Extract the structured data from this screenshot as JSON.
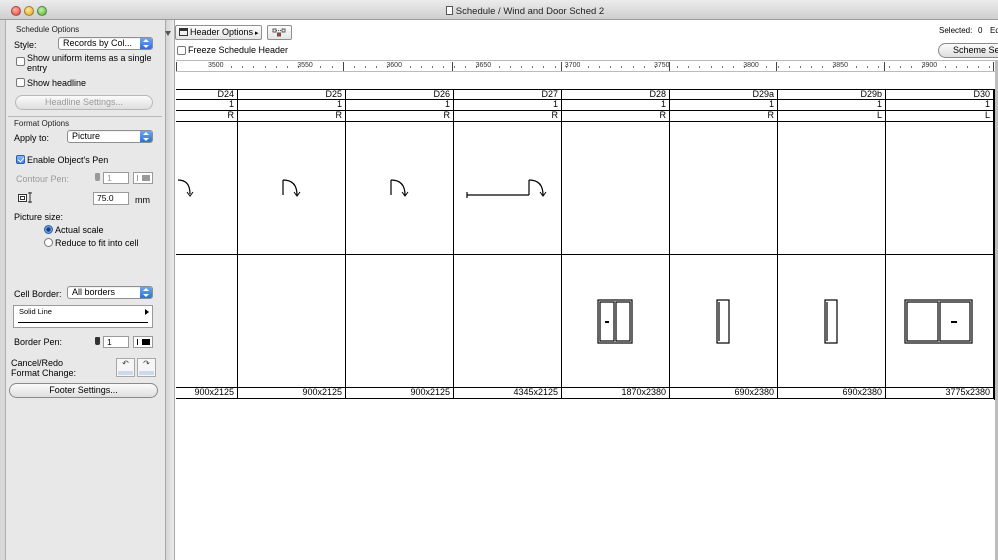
{
  "window": {
    "title": "Schedule /  Wind and Door Sched 2"
  },
  "sidebar": {
    "schedule_options": {
      "section_title": "Schedule Options",
      "style_label": "Style:",
      "style_value": "Records by Col...",
      "uniform_items_label_line1": "Show uniform items as a single",
      "uniform_items_label_line2": "entry",
      "uniform_items_checked": false,
      "show_headline_label": "Show headline",
      "show_headline_checked": false,
      "headline_settings_label": "Headline Settings..."
    },
    "format_options": {
      "section_title": "Format Options",
      "apply_to_label": "Apply to:",
      "apply_to_value": "Picture",
      "enable_pen_label": "Enable Object's Pen",
      "enable_pen_checked": true,
      "contour_pen_label": "Contour Pen:",
      "contour_pen_value": "1",
      "scale_value": "75.0",
      "scale_unit": "mm",
      "picture_size_label": "Picture size:",
      "actual_scale_label": "Actual scale",
      "reduce_fit_label": "Reduce to fit into cell",
      "picture_size_selected": "Actual scale",
      "cell_border_label": "Cell Border:",
      "cell_border_value": "All borders",
      "line_type_value": "Solid Line",
      "border_pen_label": "Border Pen:",
      "border_pen_value": "1",
      "cancel_redo_line1": "Cancel/Redo",
      "cancel_redo_line2": "Format Change:",
      "footer_settings_label": "Footer Settings..."
    }
  },
  "toolbar": {
    "header_options_label": "Header Options",
    "freeze_header_label": "Freeze Schedule Header",
    "freeze_header_checked": false,
    "selected_label": "Selected:",
    "selected_count": "0",
    "edit_truncated": "Ed",
    "scheme_settings_truncated": "Scheme Set"
  },
  "ruler": {
    "labels": [
      "3500",
      "3550",
      "3600",
      "3650",
      "3700",
      "3750",
      "3800",
      "3850",
      "3900"
    ]
  },
  "schedule": {
    "columns": [
      {
        "id": "D24",
        "qty": "1",
        "hand": "R",
        "size": "900x2125",
        "symbol": "door-swing-cut"
      },
      {
        "id": "D25",
        "qty": "1",
        "hand": "R",
        "size": "900x2125",
        "symbol": "door-swing"
      },
      {
        "id": "D26",
        "qty": "1",
        "hand": "R",
        "size": "900x2125",
        "symbol": "door-swing"
      },
      {
        "id": "D27",
        "qty": "1",
        "hand": "R",
        "size": "4345x2125",
        "symbol": "door-swing-wall"
      },
      {
        "id": "D28",
        "qty": "1",
        "hand": "R",
        "size": "1870x2380",
        "symbol": "window-double"
      },
      {
        "id": "D29a",
        "qty": "1",
        "hand": "R",
        "size": "690x2380",
        "symbol": "window-narrow"
      },
      {
        "id": "D29b",
        "qty": "1",
        "hand": "L",
        "size": "690x2380",
        "symbol": "window-narrow"
      },
      {
        "id": "D30",
        "qty": "1",
        "hand": "L",
        "size": "3775x2380",
        "symbol": "window-wide"
      }
    ]
  },
  "colors": {
    "accent": "#3a7fe0",
    "sidebar_bg": "#e8e8e8",
    "grid_line": "#000000"
  }
}
